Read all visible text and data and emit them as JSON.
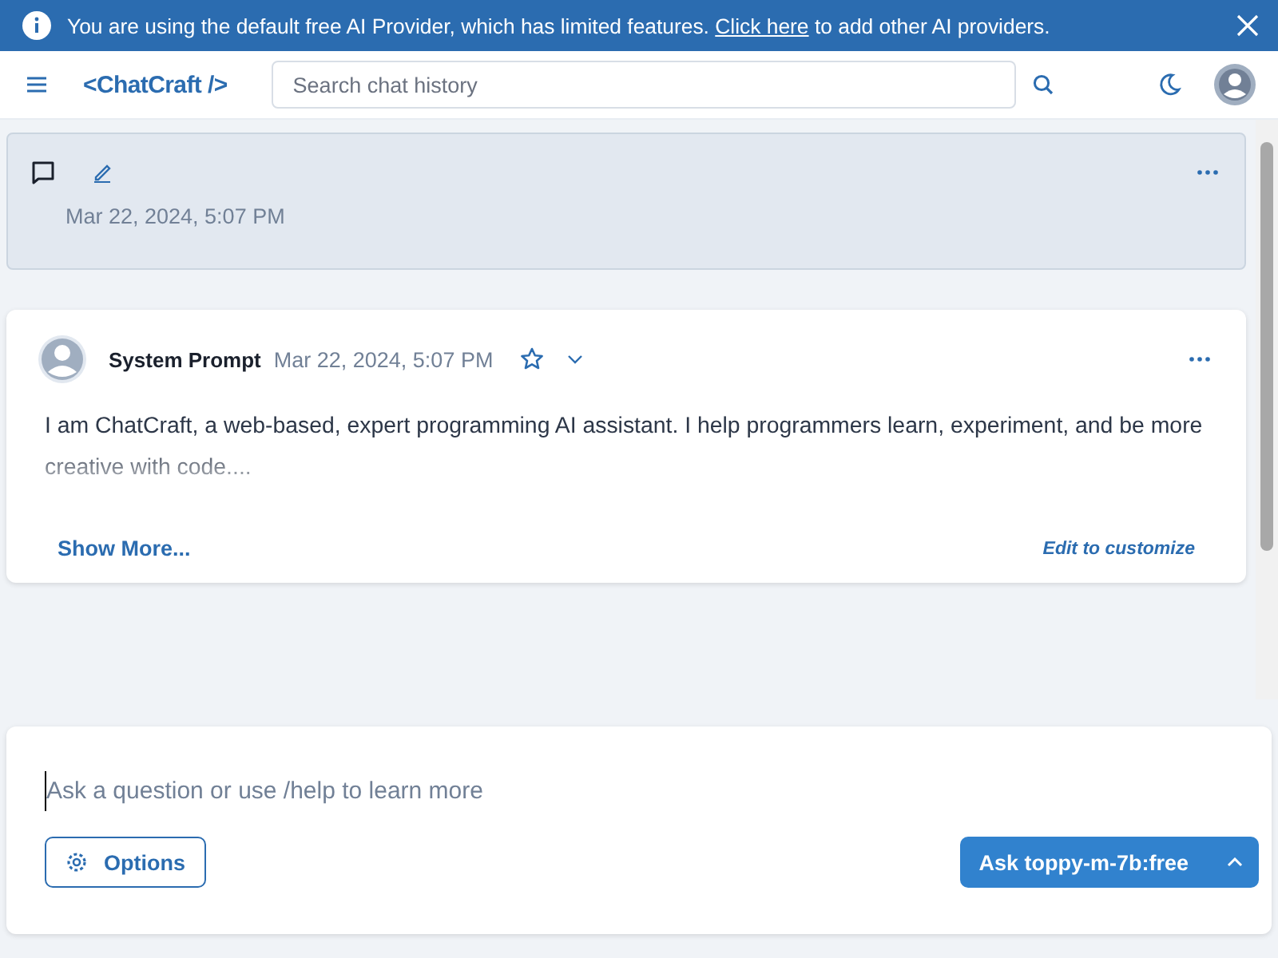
{
  "banner": {
    "text_before": "You are using the default free AI Provider, which has limited features.",
    "link": "Click here",
    "text_after": "to add other AI providers."
  },
  "header": {
    "logo": "<ChatCraft />",
    "search": {
      "placeholder": "Search chat history"
    }
  },
  "chat_summary": {
    "date": "Mar 22, 2024, 5:07 PM"
  },
  "message": {
    "author": "System Prompt",
    "date": "Mar 22, 2024, 5:07 PM",
    "starred": false,
    "text": "I am ChatCraft, a web-based, expert programming AI assistant. I help programmers learn, experiment, and be more creative with code....",
    "show_more": "Show More...",
    "edit_link": "Edit to customize"
  },
  "composer": {
    "placeholder": "Ask a question or use /help to learn more",
    "options_button": "Options",
    "ask_button": "Ask toppy-m-7b:free"
  }
}
